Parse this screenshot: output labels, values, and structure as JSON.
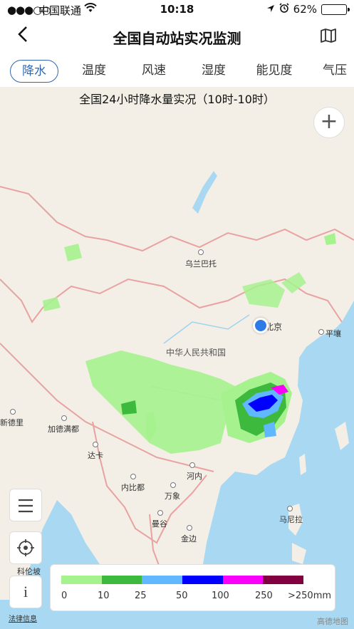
{
  "status_bar": {
    "signal": "●●●○○",
    "carrier": "中国联通",
    "time": "10:18",
    "battery": "62%",
    "battery_level": 0.62
  },
  "navbar": {
    "back_icon": "chevron-left-icon",
    "title": "全国自动站实况监测",
    "map_icon": "map-icon"
  },
  "tabs": [
    {
      "label": "降水",
      "active": true
    },
    {
      "label": "温度",
      "active": false
    },
    {
      "label": "风速",
      "active": false
    },
    {
      "label": "湿度",
      "active": false
    },
    {
      "label": "能见度",
      "active": false
    },
    {
      "label": "气压",
      "active": false
    }
  ],
  "map": {
    "title": "全国24小时降水量实况（10时-10时）",
    "zoom_in_label": "+",
    "cities": {
      "wulanbatuo": "乌兰巴托",
      "beijing": "北京",
      "pingrang": "平壤",
      "country": "中华人民共和国",
      "xindeli": "新德里",
      "jiademandu": "加德满都",
      "daka": "达卡",
      "hanoi": "河内",
      "neibidu": "内比都",
      "wanxiang": "万象",
      "mangu": "曼谷",
      "manila": "马尼拉",
      "jinbian": "金边",
      "kelunpo": "科伦坡"
    }
  },
  "side_buttons": {
    "menu_icon": "menu-icon",
    "locate_icon": "locate-icon",
    "info_label": "i"
  },
  "legend": {
    "colors": [
      "#a6f28f",
      "#3dba3d",
      "#61b8ff",
      "#0000ff",
      "#fa00fa",
      "#800040"
    ],
    "labels": [
      "0",
      "10",
      "25",
      "50",
      "100",
      "250",
      ">250mm"
    ]
  },
  "footer": {
    "law_link": "法律信息",
    "map_provider": "高德地图"
  }
}
